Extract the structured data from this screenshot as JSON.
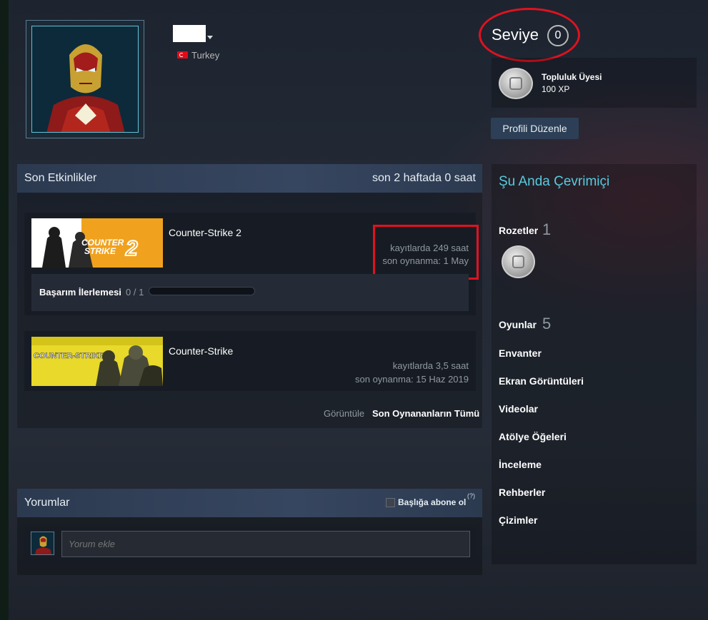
{
  "profile": {
    "country": "Turkey"
  },
  "level": {
    "label": "Seviye",
    "value": "0"
  },
  "badge": {
    "name": "Topluluk Üyesi",
    "xp": "100 XP"
  },
  "edit_profile": "Profili Düzenle",
  "activity": {
    "title": "Son Etkinlikler",
    "summary": "son 2 haftada 0 saat",
    "games": [
      {
        "title": "Counter-Strike 2",
        "banner_text": "COUNTER STRIKE 2",
        "hours": "kayıtlarda 249 saat",
        "last_played": "son oynanma: 1 May"
      },
      {
        "title": "Counter-Strike",
        "banner_text": "COUNTER-STRIKE",
        "hours": "kayıtlarda 3,5 saat",
        "last_played": "son oynanma: 15 Haz 2019"
      }
    ],
    "achievement_label": "Başarım İlerlemesi",
    "achievement_count": "0 / 1",
    "achievement_progress": 0,
    "view_label": "Görüntüle",
    "view_link": "Son Oynananların Tümü"
  },
  "comments": {
    "title": "Yorumlar",
    "subscribe": "Başlığa abone ol",
    "help": "(?)",
    "placeholder": "Yorum ekle"
  },
  "sidebar": {
    "status": "Şu Anda Çevrimiçi",
    "badges_label": "Rozetler",
    "badges_count": "1",
    "games_label": "Oyunlar",
    "games_count": "5",
    "links": [
      "Envanter",
      "Ekran Görüntüleri",
      "Videolar",
      "Atölye Öğeleri",
      "İnceleme",
      "Rehberler",
      "Çizimler"
    ]
  },
  "colors": {
    "accent_online": "#57cbde",
    "highlight_red": "#e0121f",
    "cs2_orange": "#f0a21e",
    "cs_yellow": "#e8d92a"
  },
  "icons": [
    "dropdown-caret-icon",
    "turkey-flag-icon",
    "community-badge-icon",
    "help-icon"
  ]
}
